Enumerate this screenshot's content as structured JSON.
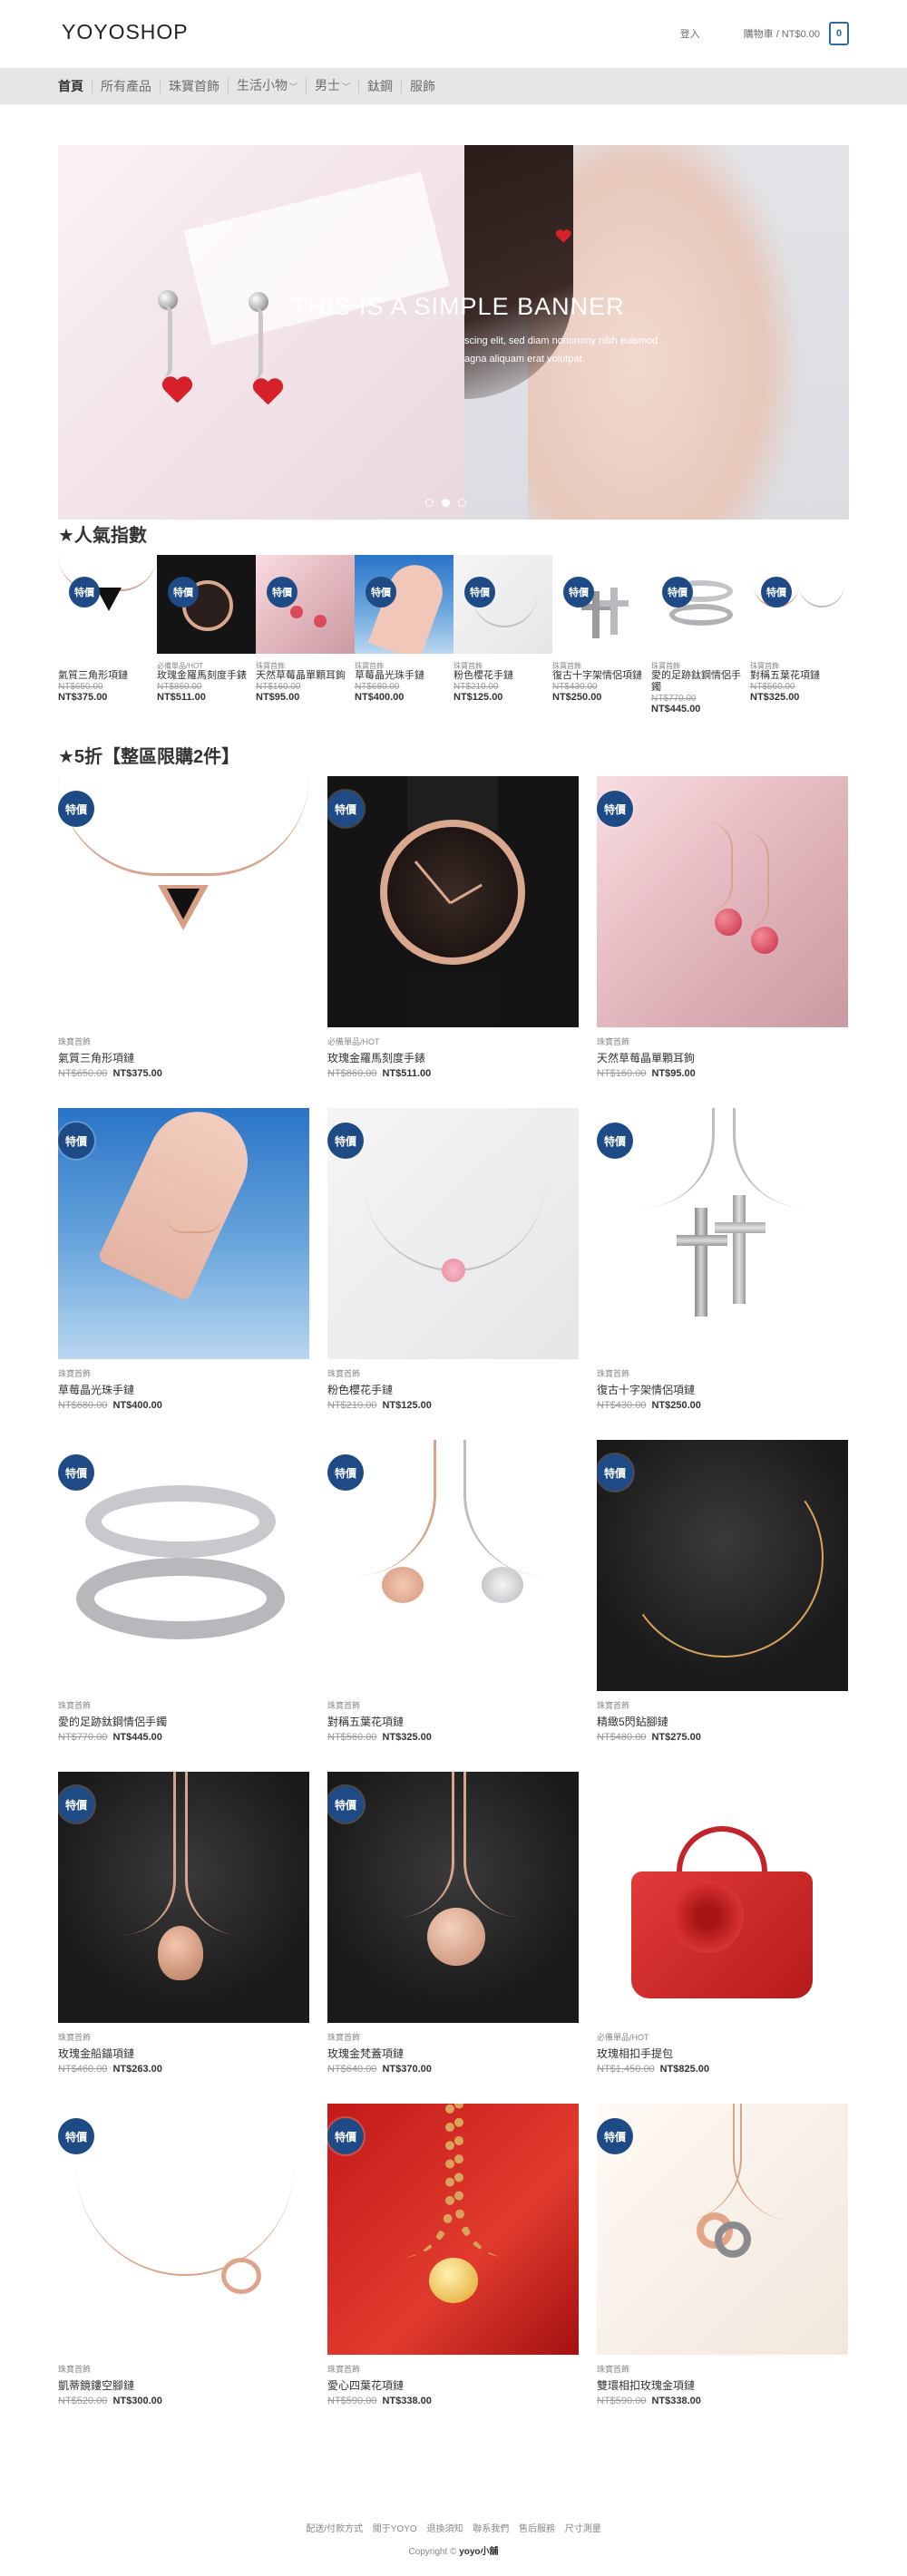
{
  "header": {
    "logo": "YOYOSHOP",
    "login": "登入",
    "cart_label": "購物車 / NT$0.00",
    "cart_count": "0"
  },
  "nav": {
    "items": [
      "首頁",
      "所有產品",
      "珠寶首飾",
      "生活小物",
      "男士",
      "鈦鋼",
      "服飾"
    ]
  },
  "banner": {
    "title": "THIS IS A SIMPLE BANNER",
    "subtitle_line1": "scing elit, sed diam nonummy nibh euismod",
    "subtitle_line2": "agna aliquam erat volutpat."
  },
  "popular": {
    "heading": "★人氣指數",
    "badge": "特價",
    "items": [
      {
        "cat": "",
        "name": "氣質三角形項鏈",
        "old": "NT$650.00",
        "new": "NT$375.00"
      },
      {
        "cat": "必備單品/HOT",
        "name": "玫瑰金羅馬刻度手錶",
        "old": "NT$860.00",
        "new": "NT$511.00"
      },
      {
        "cat": "珠寶首飾",
        "name": "天然草莓晶單顆耳鉤",
        "old": "NT$160.00",
        "new": "NT$95.00"
      },
      {
        "cat": "珠寶首飾",
        "name": "草莓晶光珠手鏈",
        "old": "NT$680.00",
        "new": "NT$400.00"
      },
      {
        "cat": "珠寶首飾",
        "name": "粉色櫻花手鏈",
        "old": "NT$210.00",
        "new": "NT$125.00"
      },
      {
        "cat": "珠寶首飾",
        "name": "復古十字架情侶項鏈",
        "old": "NT$430.00",
        "new": "NT$250.00"
      },
      {
        "cat": "珠寶首飾",
        "name": "愛的足跡鈦鋼情侶手鐲",
        "old": "NT$770.00",
        "new": "NT$445.00"
      },
      {
        "cat": "珠寶首飾",
        "name": "對稱五葉花項鏈",
        "old": "NT$560.00",
        "new": "NT$325.00"
      }
    ]
  },
  "sale": {
    "heading": "★5折【整區限購2件】",
    "badge": "特價",
    "products": [
      {
        "cat": "珠寶首飾",
        "name": "氣質三角形項鏈",
        "old": "NT$650.00",
        "new": "NT$375.00"
      },
      {
        "cat": "必備單品/HOT",
        "name": "玫瑰金羅馬刻度手錶",
        "old": "NT$860.00",
        "new": "NT$511.00"
      },
      {
        "cat": "珠寶首飾",
        "name": "天然草莓晶單顆耳鉤",
        "old": "NT$160.00",
        "new": "NT$95.00"
      },
      {
        "cat": "珠寶首飾",
        "name": "草莓晶光珠手鏈",
        "old": "NT$680.00",
        "new": "NT$400.00"
      },
      {
        "cat": "珠寶首飾",
        "name": "粉色櫻花手鏈",
        "old": "NT$210.00",
        "new": "NT$125.00"
      },
      {
        "cat": "珠寶首飾",
        "name": "復古十字架情侶項鏈",
        "old": "NT$430.00",
        "new": "NT$250.00"
      },
      {
        "cat": "珠寶首飾",
        "name": "愛的足跡鈦鋼情侶手鐲",
        "old": "NT$770.00",
        "new": "NT$445.00"
      },
      {
        "cat": "珠寶首飾",
        "name": "對稱五葉花項鏈",
        "old": "NT$560.00",
        "new": "NT$325.00"
      },
      {
        "cat": "珠寶首飾",
        "name": "精緻5閃鉆腳鏈",
        "old": "NT$480.00",
        "new": "NT$275.00"
      },
      {
        "cat": "珠寶首飾",
        "name": "玫瑰金船錨項鏈",
        "old": "NT$460.00",
        "new": "NT$263.00"
      },
      {
        "cat": "珠寶首飾",
        "name": "玫瑰金梵蓋項鏈",
        "old": "NT$640.00",
        "new": "NT$370.00"
      },
      {
        "cat": "必備單品/HOT",
        "name": "玫瑰相扣手提包",
        "old": "NT$1,450.00",
        "new": "NT$825.00"
      },
      {
        "cat": "珠寶首飾",
        "name": "凱蒂鏡鏤空腳鏈",
        "old": "NT$520.00",
        "new": "NT$300.00"
      },
      {
        "cat": "珠寶首飾",
        "name": "愛心四葉花項鏈",
        "old": "NT$590.00",
        "new": "NT$338.00"
      },
      {
        "cat": "珠寶首飾",
        "name": "雙環相扣玫瑰金項鏈",
        "old": "NT$590.00",
        "new": "NT$338.00"
      }
    ]
  },
  "footer": {
    "links": [
      "配送/付款方式",
      "關于YOYO",
      "退換須知",
      "聯系我們",
      "售后服務",
      "尺寸測量"
    ],
    "copyright_prefix": "Copyright ©",
    "copyright_name": "yoyo小舖"
  },
  "colors": {
    "accent": "#2c6ba5",
    "badge": "#1e4a86",
    "nav_bg": "#e6e6e6"
  }
}
